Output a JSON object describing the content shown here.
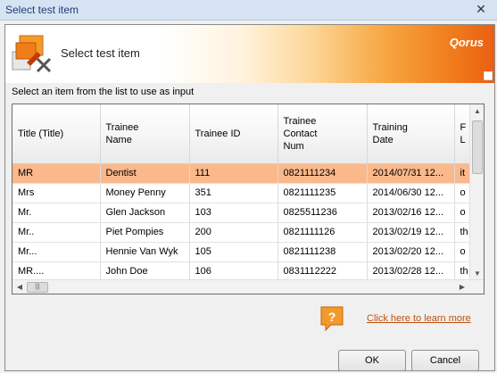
{
  "window": {
    "title": "Select test item",
    "close_glyph": "✕"
  },
  "banner": {
    "heading": "Select test item",
    "brand": "Qorus",
    "icon": "select-item-icon"
  },
  "subtitle": "Select an item from the list to use as input",
  "table": {
    "columns": [
      "Title (Title)",
      "Trainee\nName",
      "Trainee ID",
      "Trainee\nContact\nNum",
      "Training\nDate",
      "F\nL"
    ],
    "rows": [
      [
        "MR",
        "Dentist",
        "111",
        "0821111234",
        "2014/07/31 12...",
        "it"
      ],
      [
        "Mrs",
        "Money Penny",
        "351",
        "0821111235",
        "2014/06/30 12...",
        "o"
      ],
      [
        "Mr.",
        "Glen Jackson",
        "103",
        "0825511236",
        "2013/02/16 12...",
        "o"
      ],
      [
        "Mr..",
        "Piet Pompies",
        "200",
        "0821111126",
        "2013/02/19 12...",
        "th"
      ],
      [
        "Mr...",
        "Hennie Van Wyk",
        "105",
        "0821111238",
        "2013/02/20 12...",
        "o"
      ],
      [
        "MR....",
        "John Doe",
        "106",
        "0831112222",
        "2013/02/28 12...",
        "th"
      ]
    ],
    "selected_index": 0
  },
  "help": {
    "icon": "help-question-icon",
    "link": "Click here to learn more"
  },
  "buttons": {
    "ok": "OK",
    "cancel": "Cancel"
  },
  "colors": {
    "selected_row": "#fbb88a",
    "banner_accent": "#ea5f12",
    "link": "#c0500f"
  }
}
